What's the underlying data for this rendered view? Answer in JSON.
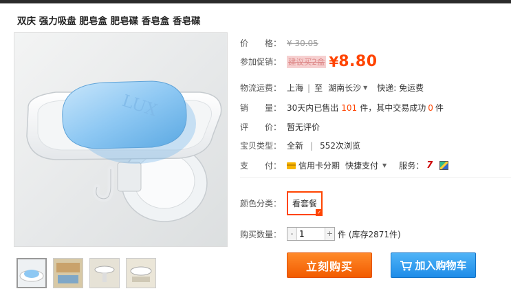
{
  "product": {
    "title": "双庆 强力吸盘 肥皂盒 肥皂碟 香皂盒 香皂碟",
    "soap_text": "LUX"
  },
  "fields": {
    "price": {
      "label": "价　　格：",
      "original": "¥ 30.05"
    },
    "promo": {
      "label": "参加促销：",
      "tag": "建议买2盒",
      "symbol": "¥",
      "value": "8.80"
    },
    "shipping": {
      "label": "物流运费：",
      "from": "上海",
      "sep": "|",
      "to_prefix": "至",
      "to": "湖南长沙",
      "fee": "快递: 免运费"
    },
    "sales": {
      "label": "销　　量：",
      "prefix": "30天内已售出",
      "count": "101",
      "mid": "件，其中交易成功",
      "success": "0",
      "suffix": "件"
    },
    "rating": {
      "label": "评　　价：",
      "value": "暂无评价"
    },
    "type": {
      "label": "宝贝类型：",
      "condition": "全新",
      "sep": "|",
      "views": "552次浏览"
    },
    "payment": {
      "label": "支　　付：",
      "card": "信用卡分期",
      "quick": "快捷支付",
      "service_label": "服务：",
      "service_icon": "7"
    },
    "color": {
      "label": "颜色分类：",
      "option": "看套餐"
    },
    "quantity": {
      "label": "购买数量：",
      "minus": "-",
      "value": "1",
      "plus": "+",
      "unit": "件 (库存2871件)"
    }
  },
  "actions": {
    "buy": "立刻购买",
    "cart": "加入购物车"
  },
  "colors": {
    "accent": "#ff4400",
    "buy_button": "#f25b00",
    "cart_button": "#1e8ce8"
  },
  "thumbnails": [
    {
      "name": "thumb-1",
      "active": true
    },
    {
      "name": "thumb-2",
      "active": false
    },
    {
      "name": "thumb-3",
      "active": false
    },
    {
      "name": "thumb-4",
      "active": false
    }
  ]
}
